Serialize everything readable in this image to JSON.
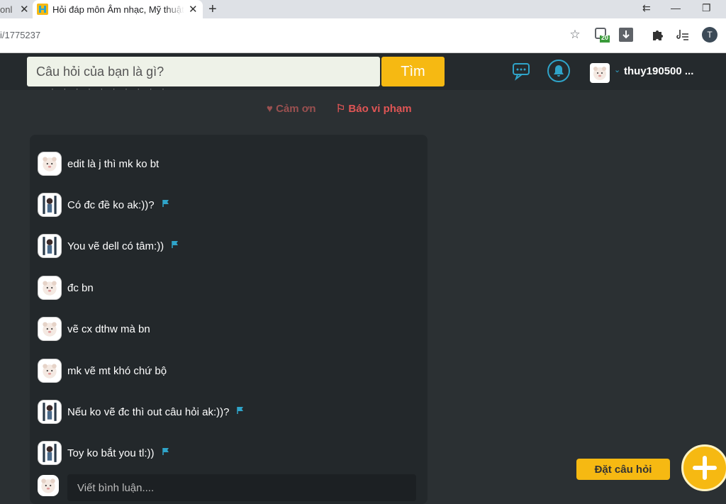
{
  "browser": {
    "tabs": [
      {
        "label": "onl"
      },
      {
        "label": "Hỏi đáp môn Âm nhạc, Mỹ thuật"
      }
    ],
    "new_tab_label": "+",
    "url": "i/1775237",
    "window_controls": [
      "minimize-icon",
      "restore-icon"
    ],
    "extension_badge": "20",
    "profile_initial": "T"
  },
  "header": {
    "search_placeholder": "Câu hỏi của bạn là gì?",
    "search_button": "Tìm",
    "username": "thuy190500 ..."
  },
  "post_actions": {
    "thank": "Cảm ơn",
    "report": "Báo vi phạm"
  },
  "comments": [
    {
      "text": "edit là j thì mk ko bt",
      "avatar": "bear",
      "flag": false
    },
    {
      "text": "Có đc đề ko ak:))?",
      "avatar": "anime",
      "flag": true
    },
    {
      "text": "You vẽ dell có tâm:))",
      "avatar": "anime",
      "flag": true
    },
    {
      "text": "đc bn",
      "avatar": "bear",
      "flag": false
    },
    {
      "text": "vẽ cx dthw mà bn",
      "avatar": "bear",
      "flag": false
    },
    {
      "text": "mk vẽ mt khó chứ bộ",
      "avatar": "bear",
      "flag": false
    },
    {
      "text": "Nếu ko vẽ đc thì out câu hỏi ak:))?",
      "avatar": "anime",
      "flag": true
    },
    {
      "text": "Toy ko bắt you tl:))",
      "avatar": "anime",
      "flag": true
    }
  ],
  "comment_input_placeholder": "Viết bình luận....",
  "ask_question_label": "Đặt câu hỏi",
  "colors": {
    "accent": "#f6b912",
    "link_blue": "#2fa4c9",
    "report_red": "#e05555"
  }
}
